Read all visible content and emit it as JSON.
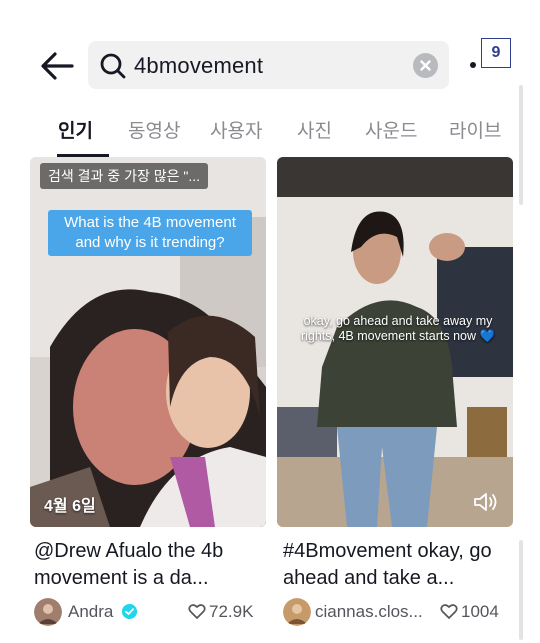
{
  "search": {
    "query": "4bmovement",
    "page_badge": "9"
  },
  "tabs": [
    {
      "label": "인기",
      "active": true
    },
    {
      "label": "동영상",
      "active": false
    },
    {
      "label": "사용자",
      "active": false
    },
    {
      "label": "사진",
      "active": false
    },
    {
      "label": "사운드",
      "active": false
    },
    {
      "label": "라이브",
      "active": false
    }
  ],
  "results": [
    {
      "overlay_tag": "검색 결과 중 가장 많은 \"...",
      "caption_box": "What is the 4B movement and why is it trending?",
      "date": "4월 6일",
      "title": "@Drew Afualo the 4b movement is a da...",
      "author": "Andra",
      "verified": true,
      "likes": "72.9K"
    },
    {
      "video_text": "okay, go ahead and take away my rights, 4B movement starts now 💙",
      "title": "#4Bmovement okay, go ahead and take a...",
      "author": "ciannas.clos...",
      "verified": false,
      "likes": "1004"
    }
  ],
  "colors": {
    "accent_caption": "#4aa6e8",
    "verified": "#20d5ec",
    "text_primary": "#161823",
    "text_secondary": "#8a8b91"
  }
}
